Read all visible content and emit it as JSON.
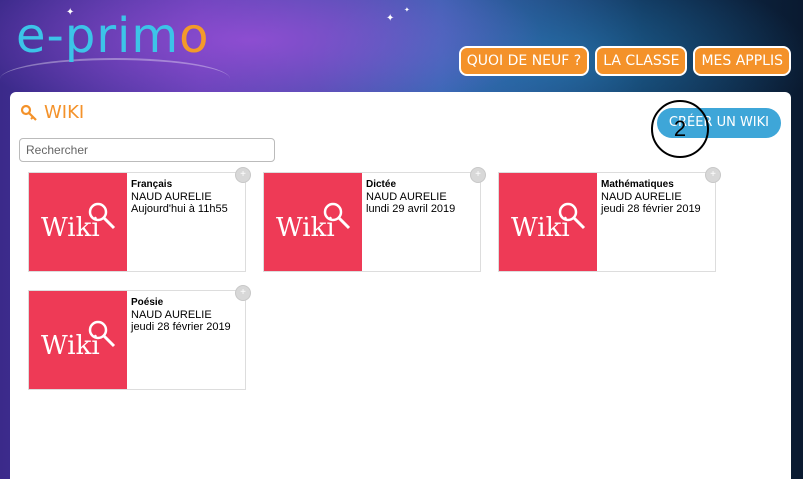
{
  "header": {
    "logo_main": "e-prim",
    "logo_o": "o",
    "nav": [
      "QUOI DE NEUF ?",
      "LA CLASSE",
      "MES APPLIS"
    ]
  },
  "panel": {
    "title": "WIKI",
    "create_button": "CRÉER UN WIKI",
    "search_placeholder": "Rechercher",
    "annotation": "2"
  },
  "wikis": [
    {
      "title": "Français",
      "author": "NAUD AURELIE",
      "date": "Aujourd'hui à 11h55",
      "thumb_label": "Wiki"
    },
    {
      "title": "Dictée",
      "author": "NAUD AURELIE",
      "date": "lundi 29 avril 2019",
      "thumb_label": "Wiki"
    },
    {
      "title": "Mathématiques",
      "author": "NAUD AURELIE",
      "date": "jeudi 28 février 2019",
      "thumb_label": "Wiki"
    },
    {
      "title": "Poésie",
      "author": "NAUD AURELIE",
      "date": "jeudi 28 février 2019",
      "thumb_label": "Wiki"
    }
  ],
  "colors": {
    "accent_orange": "#f4922a",
    "accent_blue": "#3ea6d8",
    "wiki_red": "#ee3a56",
    "logo_blue": "#3cc4e8"
  }
}
